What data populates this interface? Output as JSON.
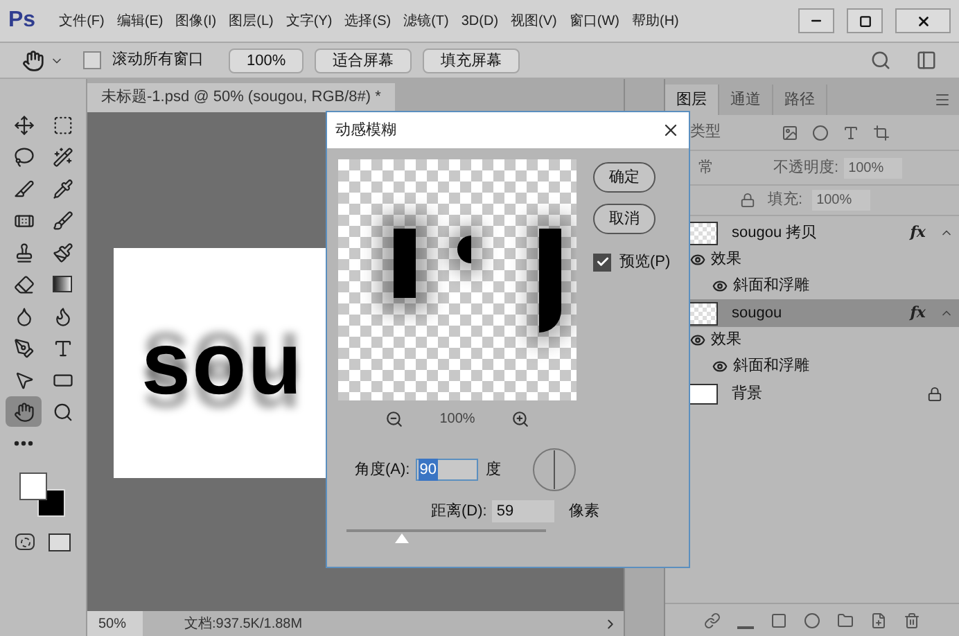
{
  "app": {
    "logo": "Ps",
    "menu": [
      "文件(F)",
      "编辑(E)",
      "图像(I)",
      "图层(L)",
      "文字(Y)",
      "选择(S)",
      "滤镜(T)",
      "3D(D)",
      "视图(V)",
      "窗口(W)",
      "帮助(H)"
    ]
  },
  "options_bar": {
    "scroll_all": {
      "label": "滚动所有窗口",
      "checked": false
    },
    "buttons": [
      "100%",
      "适合屏幕",
      "填充屏幕"
    ]
  },
  "tools": [
    {
      "kind": "move",
      "selected": false
    },
    {
      "kind": "marquee",
      "selected": false
    },
    {
      "kind": "lasso",
      "selected": false
    },
    {
      "kind": "wand",
      "selected": false
    },
    {
      "kind": "slice",
      "selected": false
    },
    {
      "kind": "eyedropper",
      "selected": false
    },
    {
      "kind": "healing",
      "selected": false
    },
    {
      "kind": "brush",
      "selected": false
    },
    {
      "kind": "stamp",
      "selected": false
    },
    {
      "kind": "history",
      "selected": false
    },
    {
      "kind": "eraser",
      "selected": false
    },
    {
      "kind": "gradient",
      "selected": false
    },
    {
      "kind": "blur",
      "selected": false
    },
    {
      "kind": "dodge",
      "selected": false
    },
    {
      "kind": "pen",
      "selected": false
    },
    {
      "kind": "type",
      "selected": false
    },
    {
      "kind": "select",
      "selected": false
    },
    {
      "kind": "shape",
      "selected": false
    },
    {
      "kind": "hand",
      "selected": true
    },
    {
      "kind": "zoom",
      "selected": false
    },
    {
      "kind": "more",
      "selected": false
    }
  ],
  "document": {
    "tab": "未标题-1.psd @ 50% (sougou, RGB/8#) *",
    "canvas_text": "sou",
    "zoom": "50%",
    "doc_info": "文档:937.5K/1.88M"
  },
  "layers_panel": {
    "tabs": [
      {
        "label": "图层",
        "selected": true
      },
      {
        "label": "通道",
        "selected": false
      },
      {
        "label": "路径",
        "selected": false
      }
    ],
    "filter": "类型",
    "blend_mode": "常",
    "opacity_label": "不透明度:",
    "opacity": "100%",
    "fill_label": "填充:",
    "fill": "100%",
    "layers": [
      {
        "name": "sougou 拷贝",
        "kind": "layer",
        "selected": false,
        "badge": "fx",
        "children": [
          {
            "name": "效果",
            "children": [
              {
                "name": "斜面和浮雕"
              }
            ]
          }
        ]
      },
      {
        "name": "sougou",
        "kind": "layer",
        "selected": true,
        "badge": "fx",
        "children": [
          {
            "name": "效果",
            "children": [
              {
                "name": "斜面和浮雕"
              }
            ]
          }
        ]
      },
      {
        "name": "背景",
        "kind": "background",
        "selected": false
      }
    ]
  },
  "dialog": {
    "title": "动感模糊",
    "buttons": [
      "确定",
      "取消"
    ],
    "preview": {
      "label": "预览(P)",
      "checked": true
    },
    "zoom": "100%",
    "angle": {
      "label": "角度(A):",
      "value": "90",
      "unit": "度"
    },
    "distance": {
      "label": "距离(D):",
      "value": "59",
      "unit": "像素",
      "level": 0.28
    }
  }
}
